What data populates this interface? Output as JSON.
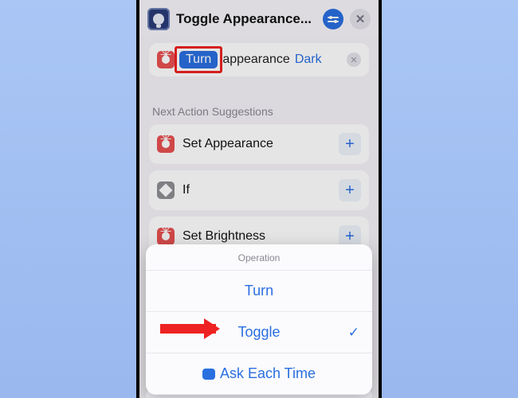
{
  "header": {
    "title": "Toggle Appearance...",
    "app_icon": "bulb-icon",
    "adjust_icon": "sliders-icon",
    "close_icon": "close-icon"
  },
  "action_card": {
    "icon": "sun-icon",
    "operation_pill": "Turn",
    "word_after": "appearance",
    "param_value": "Dark",
    "clear_icon": "clear-icon"
  },
  "suggestions": {
    "section_label": "Next Action Suggestions",
    "items": [
      {
        "icon": "sun-icon",
        "icon_color": "red",
        "label": "Set Appearance"
      },
      {
        "icon": "diamond-icon",
        "icon_color": "gray",
        "label": "If"
      },
      {
        "icon": "sun-icon",
        "icon_color": "red",
        "label": "Set Brightness"
      }
    ],
    "add_label": "+"
  },
  "sheet": {
    "title": "Operation",
    "options": [
      {
        "label": "Turn",
        "selected": false
      },
      {
        "label": "Toggle",
        "selected": true
      },
      {
        "label": "Ask Each Time",
        "selected": false,
        "is_ask": true
      }
    ]
  },
  "annotations": {
    "highlight_target": "operation-pill",
    "arrow_target": "option-toggle"
  }
}
